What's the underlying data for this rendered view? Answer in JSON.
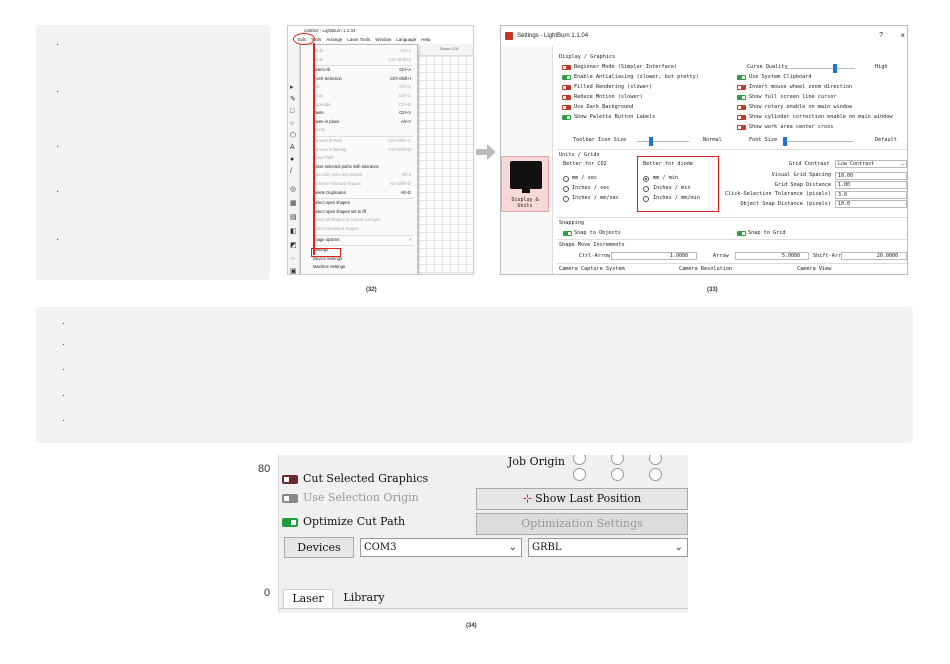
{
  "notes_top": {
    "bullets": [
      "·",
      "·",
      "·",
      "·",
      "·"
    ]
  },
  "notes_mid": {
    "bullets": [
      "·",
      "·",
      "·",
      "·",
      "·"
    ]
  },
  "fig32": {
    "caption": "(32)",
    "window_title": "untitled - LightBurn 1.1.04",
    "menubar": [
      "Edit",
      "Tools",
      "Arrange",
      "Laser Tools",
      "Window",
      "Language",
      "Help"
    ],
    "ruler_hint": "Rotate 0.00",
    "items": [
      {
        "label": "Undo",
        "sc": "Ctrl+Z",
        "dis": true
      },
      {
        "label": "Redo",
        "sc": "Ctrl+Shift+Z",
        "dis": true
      },
      {
        "label": "Select All",
        "sc": "Ctrl+A",
        "dis": false
      },
      {
        "label": "Invert Selection",
        "sc": "Ctrl+Shift+I",
        "dis": false
      },
      {
        "label": "Cut",
        "sc": "Ctrl+X",
        "dis": true
      },
      {
        "label": "Copy",
        "sc": "Ctrl+C",
        "dis": true
      },
      {
        "label": "Duplicate",
        "sc": "Ctrl+D",
        "dis": true
      },
      {
        "label": "Paste",
        "sc": "Ctrl+V",
        "dis": false
      },
      {
        "label": "Paste in place",
        "sc": "Alt+V",
        "dis": false
      },
      {
        "label": "Delete",
        "sc": "",
        "dis": true
      },
      {
        "label": "Convert to Path",
        "sc": "Ctrl+Shift+C",
        "dis": true
      },
      {
        "label": "Convert to Bitmap",
        "sc": "Ctrl+Shift+B",
        "dis": true
      },
      {
        "label": "Close Path",
        "sc": "",
        "dis": true
      },
      {
        "label": "Close selected paths with tolerance",
        "sc": "",
        "dis": false
      },
      {
        "label": "Auto-Join selected shapes",
        "sc": "Alt+J",
        "dis": true
      },
      {
        "label": "Optimize selected shapes",
        "sc": "Alt+Shift+O",
        "dis": true
      },
      {
        "label": "Delete Duplicates",
        "sc": "Alt+D",
        "dis": false
      },
      {
        "label": "Select open shapes",
        "sc": "",
        "dis": false
      },
      {
        "label": "Select open shapes set to fill",
        "sc": "",
        "dis": false
      },
      {
        "label": "Select all shapes in current cut layer",
        "sc": "",
        "dis": true
      },
      {
        "label": "Select contained shapes",
        "sc": "",
        "dis": true
      },
      {
        "label": "Image options",
        "sc": "›",
        "dis": false
      },
      {
        "label": "Settings",
        "sc": "",
        "dis": false
      },
      {
        "label": "Device Settings",
        "sc": "",
        "dis": false
      },
      {
        "label": "Machine Settings",
        "sc": "",
        "dis": false
      }
    ]
  },
  "fig33": {
    "caption": "(33)",
    "title": "Settings - LightBurn 1.1.04",
    "help": "?",
    "close": "×",
    "nav_label_1": "Display &",
    "nav_label_2": "Units",
    "sec_display": "Display / Graphics",
    "left_toggles": [
      {
        "label": "Beginner Mode (Simpler Interface)",
        "on": false
      },
      {
        "label": "Enable Antialiasing (slower, but pretty)",
        "on": true
      },
      {
        "label": "Filled Rendering (slower)",
        "on": false
      },
      {
        "label": "Reduce Motion (slower)",
        "on": false
      },
      {
        "label": "Use Dark Background",
        "on": false
      },
      {
        "label": "Show Palette Button Labels",
        "on": true
      }
    ],
    "curve_quality": "Curve Quality",
    "curve_high": "High",
    "right_toggles": [
      {
        "label": "Use System Clipboard",
        "on": true
      },
      {
        "label": "Invert mouse wheel zoom direction",
        "on": false
      },
      {
        "label": "Show full screen line cursor",
        "on": true
      },
      {
        "label": "Show rotary enable on main window",
        "on": false
      },
      {
        "label": "Show cylinder correction enable on main window",
        "on": false
      },
      {
        "label": "Show work area center cross",
        "on": false
      }
    ],
    "toolbar_icon_size": "Toolbar Icon Size",
    "toolbar_normal": "Normal",
    "font_size": "Font Size",
    "font_default": "Default",
    "sec_units": "Units / Grids",
    "co2_label": "Better for CO2",
    "co2_opts": [
      "mm / sec",
      "Inches / sec",
      "Inches / mm/sec"
    ],
    "diode_label": "Better for diode",
    "diode_opts": [
      "mm / min",
      "Inches / min",
      "Inches / mm/min"
    ],
    "grid_contrast": "Grid Contrast",
    "grid_contrast_val": "Low Contrast",
    "grid_rows": [
      {
        "label": "Visual Grid Spacing",
        "val": "10.00"
      },
      {
        "label": "Grid Snap Distance",
        "val": "1.00"
      },
      {
        "label": "Click-Selection Tolerance (pixels)",
        "val": "3.0"
      },
      {
        "label": "Object Snap Distance (pixels)",
        "val": "10.0"
      }
    ],
    "sec_snapping": "Snapping",
    "snap_objects": "Snap to Objects",
    "snap_grid": "Snap to Grid",
    "sec_move": "Shape Move Increments",
    "ctrl_arrow": "Ctrl-Arrow",
    "ctrl_val": "1.0000",
    "arrow": "Arrow",
    "arrow_val": "5.0000",
    "shift_arrow": "Shift-Arrow",
    "shift_val": "20.0000",
    "camera_capture": "Camera Capture System",
    "camera_resolution": "Camera Resolution",
    "camera_view": "Camera View"
  },
  "fig34": {
    "caption": "(34)",
    "ruler_top": "80",
    "ruler_bottom": "0",
    "job_origin": "Job Origin",
    "cut_selected": "Cut Selected Graphics",
    "use_selection_origin": "Use Selection Origin",
    "optimize_cut_path": "Optimize Cut Path",
    "show_last_position": "Show Last Position",
    "optimization_settings": "Optimization Settings",
    "devices": "Devices",
    "port": "COM3",
    "controller": "GRBL",
    "tab_laser": "Laser",
    "tab_library": "Library"
  },
  "colors": {
    "accent_red": "#e02020",
    "toggle_on": "#2e9e42",
    "toggle_off": "#c0392b",
    "note_bg": "#f2f2f2"
  }
}
